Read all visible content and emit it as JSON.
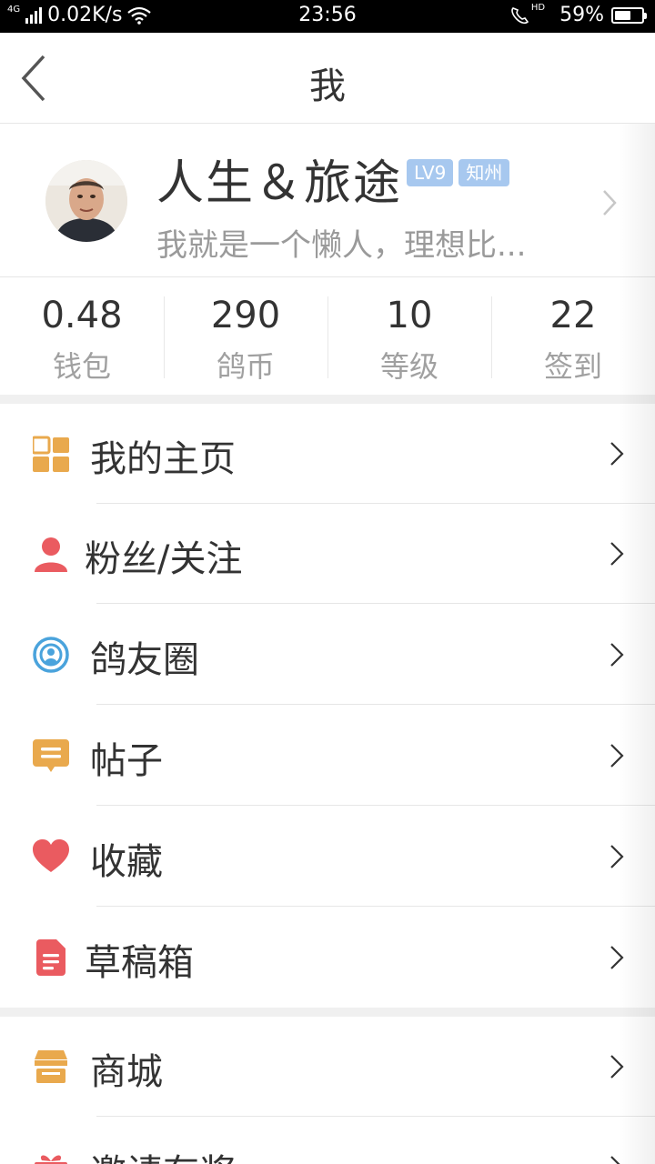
{
  "status_bar": {
    "network_type": "4G",
    "speed": "0.02K/s",
    "time": "23:56",
    "hd_label": "HD",
    "battery_percent": "59%",
    "battery_level": 0.59
  },
  "header": {
    "title": "我"
  },
  "profile": {
    "name": "人生＆旅途",
    "level_badge": "LV9",
    "title_badge": "知州",
    "signature": "我就是一个懒人，理想比..."
  },
  "stats": [
    {
      "value": "0.48",
      "label": "钱包"
    },
    {
      "value": "290",
      "label": "鸽币"
    },
    {
      "value": "10",
      "label": "等级"
    },
    {
      "value": "22",
      "label": "签到"
    }
  ],
  "menu": [
    {
      "label": "我的主页",
      "icon": "grid-icon",
      "color": "#e9a94d"
    },
    {
      "label": "粉丝/关注",
      "icon": "person-icon",
      "color": "#ea5b60"
    },
    {
      "label": "鸽友圈",
      "icon": "broadcast-icon",
      "color": "#4aa3dc"
    },
    {
      "label": "帖子",
      "icon": "message-icon",
      "color": "#e9a94d"
    },
    {
      "label": "收藏",
      "icon": "heart-icon",
      "color": "#ea5b60"
    },
    {
      "label": "草稿箱",
      "icon": "document-icon",
      "color": "#ea5b60"
    },
    {
      "label": "商城",
      "icon": "shop-icon",
      "color": "#e9a94d"
    },
    {
      "label": "邀请有奖",
      "icon": "gift-icon",
      "color": "#ea5b60"
    }
  ],
  "colors": {
    "badge_bg": "#a7c8ef",
    "text_primary": "#333333",
    "text_secondary": "#9a9a9a",
    "orange": "#e9a94d",
    "red": "#ea5b60",
    "blue": "#4aa3dc"
  }
}
